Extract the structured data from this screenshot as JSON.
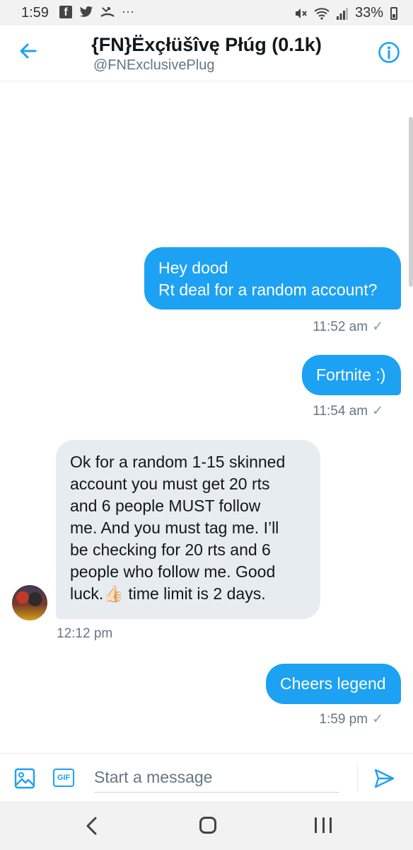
{
  "status_bar": {
    "time": "1:59",
    "dots": "···",
    "battery": "33%"
  },
  "header": {
    "title": "{FN}Ëxçłüšîvę Płúg (0.1k)",
    "handle": "@FNExclusivePlug"
  },
  "messages": [
    {
      "direction": "outgoing",
      "lines": [
        "Hey dood",
        "Rt deal for a random account?"
      ],
      "time": "11:52 am",
      "read_check": "✓"
    },
    {
      "direction": "outgoing",
      "lines": [
        "Fortnite :)"
      ],
      "time": "11:54 am",
      "read_check": "✓"
    },
    {
      "direction": "incoming",
      "lines": [
        "Ok for a random 1-15 skinned",
        "account you must get 20 rts",
        "and 6 people MUST follow",
        "me. And you must tag me. I’ll",
        "be checking for 20 rts and 6",
        "people who follow me. Good",
        "luck.👍🏻 time limit is 2 days."
      ],
      "time": "12:12 pm"
    },
    {
      "direction": "outgoing",
      "lines": [
        "Cheers legend"
      ],
      "time": "1:59 pm",
      "read_check": "✓"
    }
  ],
  "composer": {
    "placeholder": "Start a message",
    "gif_label": "GIF"
  },
  "colors": {
    "accent": "#1da1f2",
    "incoming_bubble": "#e6ecf0",
    "muted_text": "#657786"
  },
  "icons": {
    "header_left": "back-arrow-icon",
    "header_right": "info-icon",
    "composer_left": "image-icon",
    "composer_gif": "gif-icon",
    "composer_right": "send-icon"
  }
}
